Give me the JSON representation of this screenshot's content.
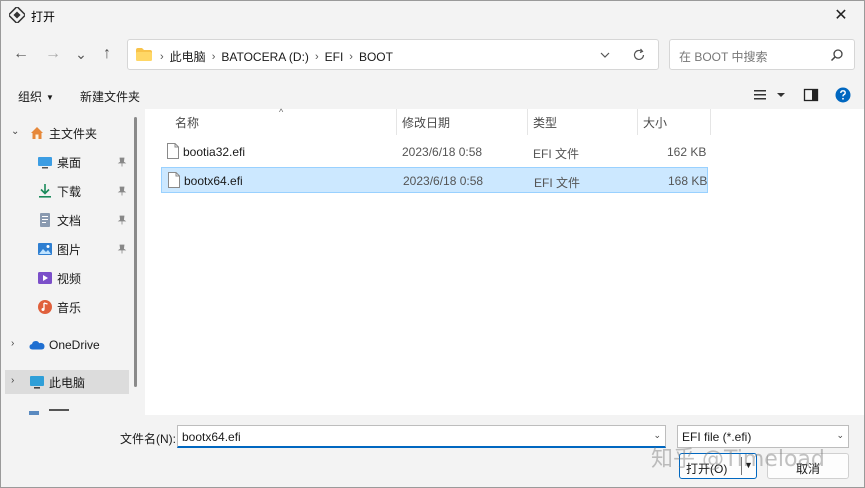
{
  "window": {
    "title": "打开",
    "close": "✕"
  },
  "nav": {
    "back": "←",
    "forward": "→",
    "recent": "⌄",
    "up": "↑"
  },
  "address": {
    "crumbs": [
      "此电脑",
      "BATOCERA (D:)",
      "EFI",
      "BOOT"
    ],
    "sep": "›"
  },
  "search": {
    "placeholder": "在 BOOT 中搜索"
  },
  "toolbar": {
    "organize": "组织",
    "new_folder": "新建文件夹",
    "caret": "▼"
  },
  "sidebar": {
    "items": [
      {
        "label": "主文件夹"
      },
      {
        "label": "桌面"
      },
      {
        "label": "下载"
      },
      {
        "label": "文档"
      },
      {
        "label": "图片"
      },
      {
        "label": "视频"
      },
      {
        "label": "音乐"
      },
      {
        "label": "OneDrive"
      },
      {
        "label": "此电脑"
      }
    ]
  },
  "columns": {
    "name": "名称",
    "modified": "修改日期",
    "type": "类型",
    "size": "大小",
    "sort_caret": "^"
  },
  "files": [
    {
      "name": "bootia32.efi",
      "modified": "2023/6/18 0:58",
      "type": "EFI 文件",
      "size": "162 KB"
    },
    {
      "name": "bootx64.efi",
      "modified": "2023/6/18 0:58",
      "type": "EFI 文件",
      "size": "168 KB"
    }
  ],
  "footer": {
    "filename_label": "文件名(N):",
    "filename_value": "bootx64.efi",
    "filetype": "EFI file (*.efi)",
    "open": "打开(O)",
    "cancel": "取消",
    "dropdown": "▼"
  },
  "watermark": "知乎 @Timeload",
  "colors": {
    "accent": "#0067c0",
    "selection": "#cce8ff",
    "folder": "#f8c34a"
  }
}
